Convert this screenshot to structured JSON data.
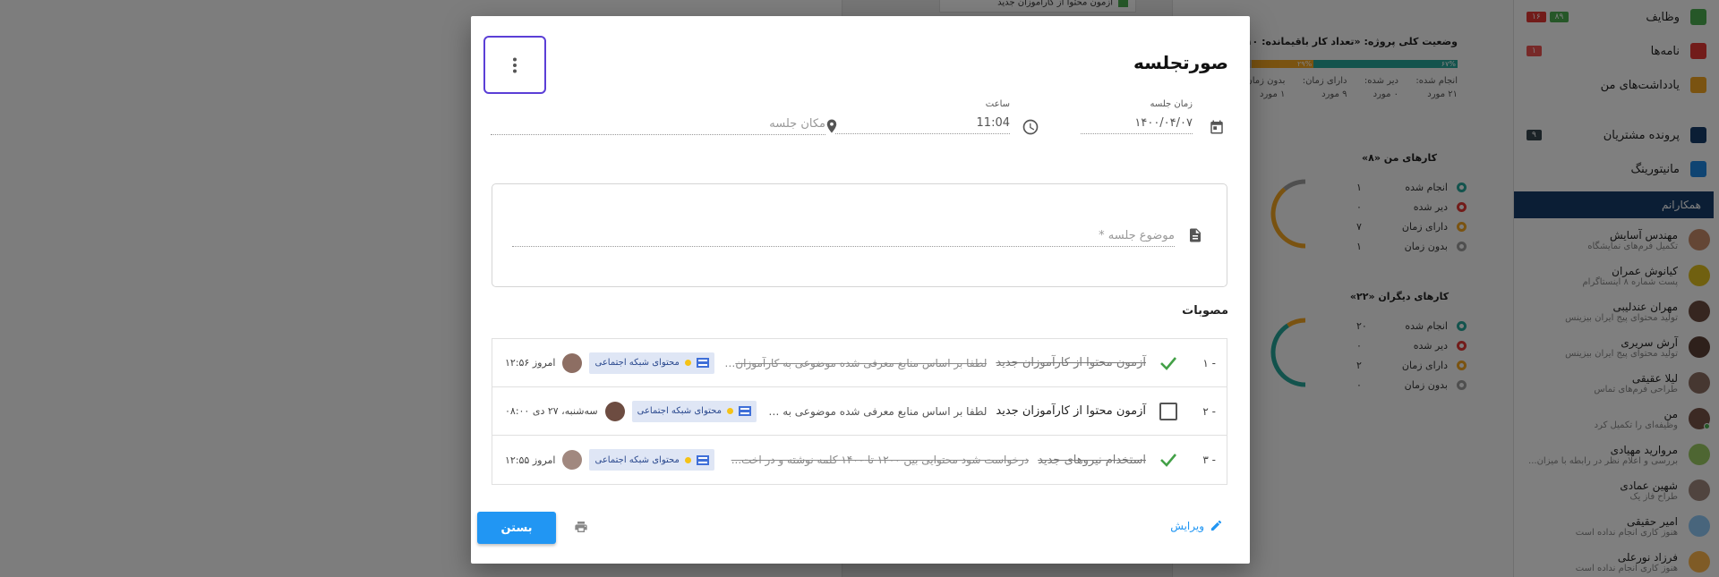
{
  "modal": {
    "title": "صورتجلسه",
    "date_label": "زمان جلسه",
    "date_value": "۱۴۰۰/۰۴/۰۷",
    "time_label": "ساعت",
    "time_value": "11:04",
    "location_placeholder": "مکان جلسه",
    "subject_placeholder": "موضوع جلسه *",
    "approvals_title": "مصوبات",
    "approvals": [
      {
        "num": "۱ -",
        "done": true,
        "title": "آزمون محتوا از کارآموزان جدید",
        "desc": "لطفا بر اساس منابع معرفی شده موضوعی به کارآموزان دا...",
        "tag": "محتوای شبکه اجتماعی",
        "date": "امروز ۱۲:۵۶"
      },
      {
        "num": "۲ -",
        "done": false,
        "title": "آزمون محتوا از کارآموزان جدید",
        "desc": "لطفا بر اساس منابع معرفی شده موضوعی به ک...",
        "tag": "محتوای شبکه اجتماعی",
        "date": "سه‌شنبه، ۲۷ دی ۰۸:۰۰"
      },
      {
        "num": "۳ -",
        "done": true,
        "title": "استخدام نیروهای جدید",
        "desc": "درخواست شود محتوایی بین ۱۲۰۰ تا ۱۴۰۰ کلمه نوشته و در اخت...",
        "tag": "محتوای شبکه اجتماعی",
        "date": "امروز ۱۲:۵۵"
      }
    ],
    "edit_label": "ویرایش",
    "close_label": "بستن"
  },
  "background": {
    "board_snippet": "آزمون محتوا از کارآموزان جدید",
    "project_status": {
      "title": "وضعیت کلی پروژه: «تعداد کار باقیمانده: ۱۰»",
      "bar": [
        {
          "label": "۶۷%",
          "value": 67,
          "color": "#26a69a"
        },
        {
          "label": "۲۹%",
          "value": 29,
          "color": "#f5a623"
        },
        {
          "label": "",
          "value": 4,
          "color": "#cfcfcf"
        }
      ],
      "cols": [
        {
          "label": "انجام شده:",
          "value": "۲۱ مورد"
        },
        {
          "label": "دیر شده:",
          "value": "۰ مورد"
        },
        {
          "label": "دارای زمان:",
          "value": "۹ مورد"
        },
        {
          "label": "بدون زمان:",
          "value": "۱ مورد"
        }
      ]
    },
    "my_tasks": {
      "title": "کارهای من «۸»",
      "rows": [
        {
          "label": "انجام شده",
          "value": "۱",
          "color": "#26a69a"
        },
        {
          "label": "دیر شده",
          "value": "۰",
          "color": "#e53935"
        },
        {
          "label": "دارای زمان",
          "value": "۷",
          "color": "#f5a623"
        },
        {
          "label": "بدون زمان",
          "value": "۱",
          "color": "#9e9e9e"
        }
      ]
    },
    "others_tasks": {
      "title": "کارهای دیگران «۲۲»",
      "rows": [
        {
          "label": "انجام شده",
          "value": "۲۰",
          "color": "#26a69a"
        },
        {
          "label": "دیر شده",
          "value": "۰",
          "color": "#e53935"
        },
        {
          "label": "دارای زمان",
          "value": "۲",
          "color": "#f5a623"
        },
        {
          "label": "بدون زمان",
          "value": "۰",
          "color": "#9e9e9e"
        }
      ]
    },
    "sidebar": {
      "menu": [
        {
          "label": "وظایف",
          "icon_color": "#4caf50",
          "badges": [
            {
              "text": "۸۹",
              "color": "#4caf50"
            },
            {
              "text": "۱۶",
              "color": "#e53935"
            }
          ]
        },
        {
          "label": "نامه‌ها",
          "icon_color": "#e53935",
          "badges": [
            {
              "text": "۱",
              "color": "#ef5350"
            }
          ]
        },
        {
          "label": "یادداشت‌های من",
          "icon_color": "#f5a623",
          "badges": []
        },
        {
          "label": "پرونده مشتریان",
          "icon_color": "#173d6b",
          "badges": [
            {
              "text": "۹",
              "color": "#37474f"
            }
          ]
        },
        {
          "label": "مانیتورینگ",
          "icon_color": "#1e88e5",
          "badges": []
        }
      ],
      "colleagues_title": "همکارانم",
      "colleagues": [
        {
          "name": "مهندس آسایش",
          "sub": "تکمیل فرم‌های نمایشگاه",
          "color": "#c98d6a",
          "online": false
        },
        {
          "name": "کیانوش عمران",
          "sub": "پست شماره ۸ اینستاگرام",
          "color": "#e0c021",
          "online": false
        },
        {
          "name": "مهران عندلیبی",
          "sub": "تولید محتوای پیج ایران بیزینس",
          "color": "#6d4c41",
          "online": false
        },
        {
          "name": "آرش سریری",
          "sub": "تولید محتوای پیج ایران بیزینس",
          "color": "#5d4037",
          "online": false
        },
        {
          "name": "لیلا عقیقی",
          "sub": "طراحی فرم‌های تماس",
          "color": "#8d6e63",
          "online": false
        },
        {
          "name": "من",
          "sub": "وظیفه‌ای را تکمیل کرد",
          "color": "#795548",
          "online": true
        },
        {
          "name": "مروارید مهیادی",
          "sub": "بررسی و اعلام نظر در رابطه با میزان...",
          "color": "#9ccc65",
          "online": false
        },
        {
          "name": "شهین عمادی",
          "sub": "طراح فاز یک",
          "color": "#a1887f",
          "online": false
        },
        {
          "name": "امیر حقیقی",
          "sub": "هنوز کاری انجام نداده است",
          "color": "#90caf9",
          "online": false
        },
        {
          "name": "فرزاد نورعلی",
          "sub": "هنوز کاری انجام نداده است",
          "color": "#ffb74d",
          "online": false
        }
      ]
    }
  }
}
